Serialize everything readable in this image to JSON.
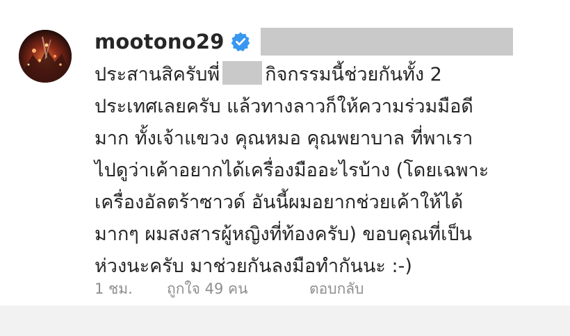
{
  "comment": {
    "username": "mootono29",
    "verified_icon": "verified-badge-icon",
    "avatar_icon": "profile-photo",
    "lines": [
      {
        "before": "ประสานสิครับพี่",
        "after": "กิจกรรมนี้ช่วยกันทั้ง 2"
      },
      "ประเทศเลยครับ แล้วทางลาวก็ให้ความร่วมมือดี",
      "มาก ทั้งเจ้าแขวง คุณหมอ คุณพยาบาล ที่พาเรา",
      "ไปดูว่าเค้าอยากได้เครื่องมืออะไรบ้าง (โดยเฉพาะ",
      "เครื่องอัลตร้าซาวด์ อันนี้ผมอยากช่วยเค้าให้ได้",
      "มากๆ ผมสงสารผู้หญิงที่ท้องครับ) ขอบคุณที่เป็น",
      "ห่วงนะครับ มาช่วยกันลงมือทำกันนะ :-)"
    ],
    "meta": {
      "time": "1 ชม.",
      "likes": "ถูกใจ 49 คน",
      "reply": "ตอบกลับ"
    }
  },
  "colors": {
    "text": "#262626",
    "secondary_text": "#8e8e8e",
    "verified_blue": "#3897f0",
    "redaction": "#c9c9c9",
    "footer_background": "#f2f2f2"
  }
}
